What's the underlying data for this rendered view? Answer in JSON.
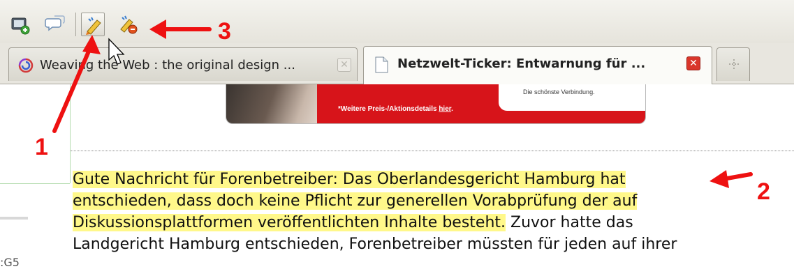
{
  "toolbar": {
    "buttons": [
      {
        "icon": "add-comment-icon"
      },
      {
        "icon": "speech-bubbles-icon"
      },
      {
        "icon": "highlighter-pen-icon",
        "active": true
      },
      {
        "icon": "highlighter-remove-icon"
      }
    ]
  },
  "tabs": [
    {
      "title": "Weaving the Web : the original design ...",
      "icon": "swirl-favicon-icon",
      "selected": false
    },
    {
      "title": "Netzwelt-Ticker: Entwarnung für ...",
      "icon": "document-icon",
      "selected": true
    }
  ],
  "new_tab": {
    "icon": "new-tab-icon"
  },
  "ad": {
    "slogan": "Die schönste Verbindung.",
    "text": "*Weitere Preis-/Aktionsdetails ",
    "link": "hier",
    "after": "."
  },
  "article": {
    "highlighted": [
      "Gute Nachricht für Forenbetreiber: Das Oberlandesgericht Hamburg hat",
      "entschieden, dass doch keine Pflicht zur generellen Vorabprüfung der auf",
      "Diskussionsplattformen veröffentlichten Inhalte besteht."
    ],
    "normal_line3_tail": " Zuvor hatte das",
    "normal_line4": "Landgericht Hamburg entschieden, Forenbetreiber müssten für jeden auf ihrer"
  },
  "left_fragment": ":G5",
  "annotations": {
    "label_1": "1",
    "label_2": "2",
    "label_3": "3",
    "color": "#ee1111"
  },
  "colors": {
    "highlight": "#fff88a",
    "ad_red": "#d7141a",
    "close_active": "#d9362b"
  }
}
